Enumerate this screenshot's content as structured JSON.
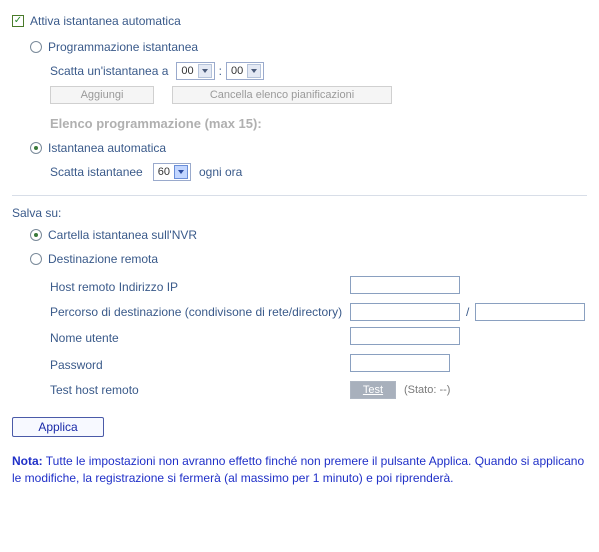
{
  "activate": {
    "label": "Attiva istantanea automatica",
    "checked": true
  },
  "modes": {
    "scheduled": {
      "label": "Programmazione istantanea",
      "selected": false,
      "take_at_label": "Scatta un'istantanea a",
      "hour_value": "00",
      "minute_value": "00",
      "add_label": "Aggiungi",
      "clear_label": "Cancella elenco pianificazioni",
      "list_header": "Elenco programmazione (max 15):"
    },
    "automatic": {
      "label": "Istantanea automatica",
      "selected": true,
      "take_label": "Scatta istantanee",
      "interval_value": "60",
      "every_hour_label": "ogni ora"
    }
  },
  "save_to": {
    "header": "Salva su:",
    "nvr": {
      "label": "Cartella istantanea sull'NVR",
      "selected": true
    },
    "remote": {
      "label": "Destinazione remota",
      "selected": false,
      "fields": {
        "host_label": "Host remoto Indirizzo IP",
        "path_label": "Percorso di destinazione (condivisone di rete/directory)",
        "user_label": "Nome utente",
        "password_label": "Password",
        "test_label": "Test host remoto",
        "test_button": "Test",
        "status_text": "(Stato: --)"
      }
    }
  },
  "apply_label": "Applica",
  "note_label": "Nota:",
  "note_text": "Tutte le impostazioni non avranno effetto finché non premere il pulsante Applica. Quando si applicano le modifiche, la registrazione si fermerà (al massimo per 1 minuto) e poi riprenderà."
}
